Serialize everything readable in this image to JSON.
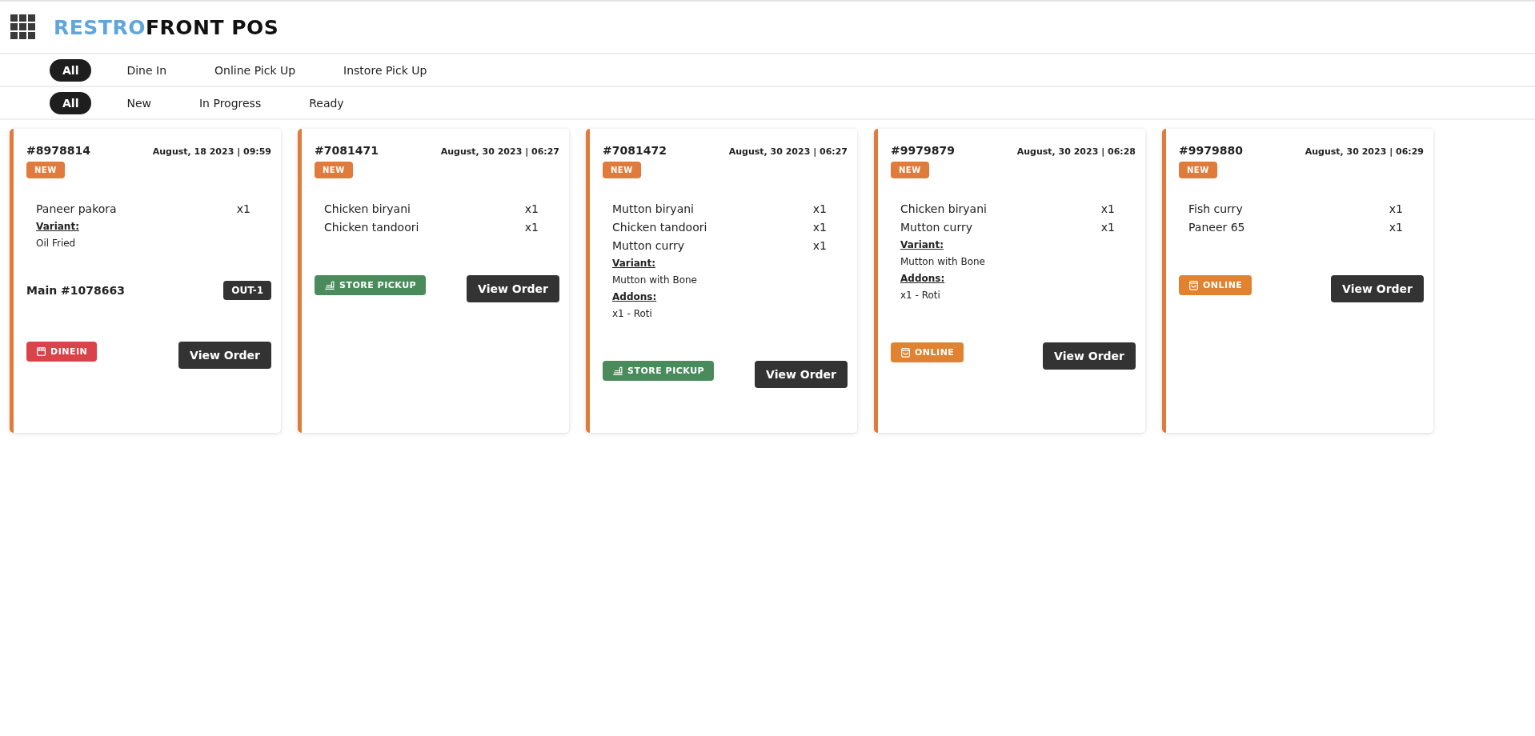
{
  "header": {
    "logo": {
      "accent": "RESTRO",
      "rest": "FRONT POS"
    }
  },
  "order_type_tabs": [
    {
      "label": "All",
      "selected": true
    },
    {
      "label": "Dine In",
      "selected": false
    },
    {
      "label": "Online Pick Up",
      "selected": false
    },
    {
      "label": "Instore Pick Up",
      "selected": false
    }
  ],
  "status_tabs": [
    {
      "label": "All",
      "selected": true
    },
    {
      "label": "New",
      "selected": false
    },
    {
      "label": "In Progress",
      "selected": false
    },
    {
      "label": "Ready",
      "selected": false
    }
  ],
  "orders": [
    {
      "number": "#8978814",
      "datetime": "August, 18 2023 | 09:59",
      "status": "NEW",
      "items": [
        {
          "name": "Paneer pakora",
          "qty": "x1"
        }
      ],
      "notes": [
        {
          "kind": "heading",
          "text": "Variant:"
        },
        {
          "kind": "text",
          "text": "Oil Fried"
        }
      ],
      "table": {
        "ref": "Main #1078663",
        "tag": "OUT-1"
      },
      "type": {
        "kind": "dinein",
        "label": "DINEIN"
      },
      "button": "View Order"
    },
    {
      "number": "#7081471",
      "datetime": "August, 30 2023 | 06:27",
      "status": "NEW",
      "items": [
        {
          "name": "Chicken biryani",
          "qty": "x1"
        },
        {
          "name": "Chicken tandoori",
          "qty": "x1"
        }
      ],
      "type": {
        "kind": "store_pickup",
        "label": "STORE PICKUP"
      },
      "button": "View Order"
    },
    {
      "number": "#7081472",
      "datetime": "August, 30 2023 | 06:27",
      "status": "NEW",
      "items": [
        {
          "name": "Mutton biryani",
          "qty": "x1"
        },
        {
          "name": "Chicken tandoori",
          "qty": "x1"
        },
        {
          "name": "Mutton curry",
          "qty": "x1"
        }
      ],
      "notes": [
        {
          "kind": "heading",
          "text": "Variant:"
        },
        {
          "kind": "text",
          "text": "Mutton with Bone"
        },
        {
          "kind": "heading",
          "text": "Addons:"
        },
        {
          "kind": "text",
          "text": "x1 - Roti"
        }
      ],
      "type": {
        "kind": "store_pickup",
        "label": "STORE PICKUP"
      },
      "button": "View Order"
    },
    {
      "number": "#9979879",
      "datetime": "August, 30 2023 | 06:28",
      "status": "NEW",
      "items": [
        {
          "name": "Chicken biryani",
          "qty": "x1"
        },
        {
          "name": "Mutton curry",
          "qty": "x1"
        }
      ],
      "notes": [
        {
          "kind": "heading",
          "text": "Variant:"
        },
        {
          "kind": "text",
          "text": "Mutton with Bone"
        },
        {
          "kind": "heading",
          "text": "Addons:"
        },
        {
          "kind": "text",
          "text": "x1 - Roti"
        }
      ],
      "type": {
        "kind": "online",
        "label": "ONLINE"
      },
      "button": "View Order"
    },
    {
      "number": "#9979880",
      "datetime": "August, 30 2023 | 06:29",
      "status": "NEW",
      "items": [
        {
          "name": "Fish curry",
          "qty": "x1"
        },
        {
          "name": "Paneer 65",
          "qty": "x1"
        }
      ],
      "type": {
        "kind": "online",
        "label": "ONLINE"
      },
      "button": "View Order"
    }
  ]
}
